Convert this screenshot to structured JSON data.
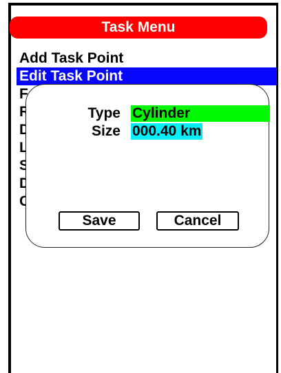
{
  "header": {
    "title": "Task Menu"
  },
  "menu": {
    "items": [
      {
        "label": "Add Task Point",
        "selected": false
      },
      {
        "label": "Edit Task Point",
        "selected": true
      },
      {
        "label": "F",
        "selected": false
      },
      {
        "label": "R",
        "selected": false
      },
      {
        "label": "D",
        "selected": false
      },
      {
        "label": "L",
        "selected": false
      },
      {
        "label": "S",
        "selected": false
      },
      {
        "label": "D",
        "selected": false
      },
      {
        "label": "C",
        "selected": false
      }
    ]
  },
  "dialog": {
    "type_label": "Type",
    "type_value": "Cylinder",
    "size_label": "Size",
    "size_value": "000.40 km",
    "save_label": "Save",
    "cancel_label": "Cancel"
  },
  "colors": {
    "title_bar": "#fe0000",
    "selected_item": "#0707fb",
    "type_highlight": "#00f900",
    "size_highlight": "#00f0fb"
  }
}
